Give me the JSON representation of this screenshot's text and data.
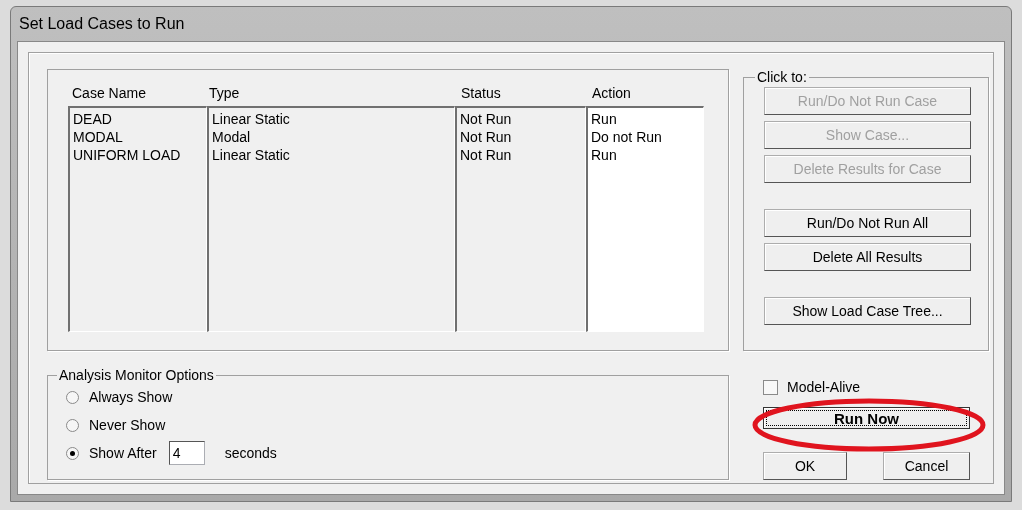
{
  "window": {
    "title": "Set Load Cases to Run"
  },
  "cases_table": {
    "columns": [
      "Case Name",
      "Type",
      "Status",
      "Action"
    ],
    "rows": [
      {
        "cells": [
          "DEAD",
          "Linear Static",
          "Not Run",
          "Run"
        ]
      },
      {
        "cells": [
          "MODAL",
          "Modal",
          "Not Run",
          "Do not Run"
        ]
      },
      {
        "cells": [
          "UNIFORM LOAD",
          "Linear Static",
          "Not Run",
          "Run"
        ]
      }
    ]
  },
  "click_to": {
    "label": "Click to:",
    "groups": [
      {
        "buttons": [
          {
            "label": "Run/Do Not Run Case",
            "disabled": true
          },
          {
            "label": "Show Case...",
            "disabled": true
          },
          {
            "label": "Delete Results for Case",
            "disabled": true
          }
        ]
      },
      {
        "buttons": [
          {
            "label": "Run/Do Not Run All",
            "disabled": false
          },
          {
            "label": "Delete All Results",
            "disabled": false
          }
        ]
      },
      {
        "buttons": [
          {
            "label": "Show Load Case Tree...",
            "disabled": false
          }
        ]
      }
    ]
  },
  "monitor_options": {
    "label": "Analysis Monitor Options",
    "options": [
      {
        "label": "Always Show",
        "selected": false
      },
      {
        "label": "Never Show",
        "selected": false
      },
      {
        "label": "Show After",
        "selected": true
      }
    ],
    "seconds_field": {
      "value": "4"
    },
    "unit": "seconds"
  },
  "model_alive": {
    "label": "Model-Alive",
    "checked": false
  },
  "run_now": {
    "label": "Run Now",
    "focused": true
  },
  "buttons": [
    "OK",
    "Cancel"
  ]
}
